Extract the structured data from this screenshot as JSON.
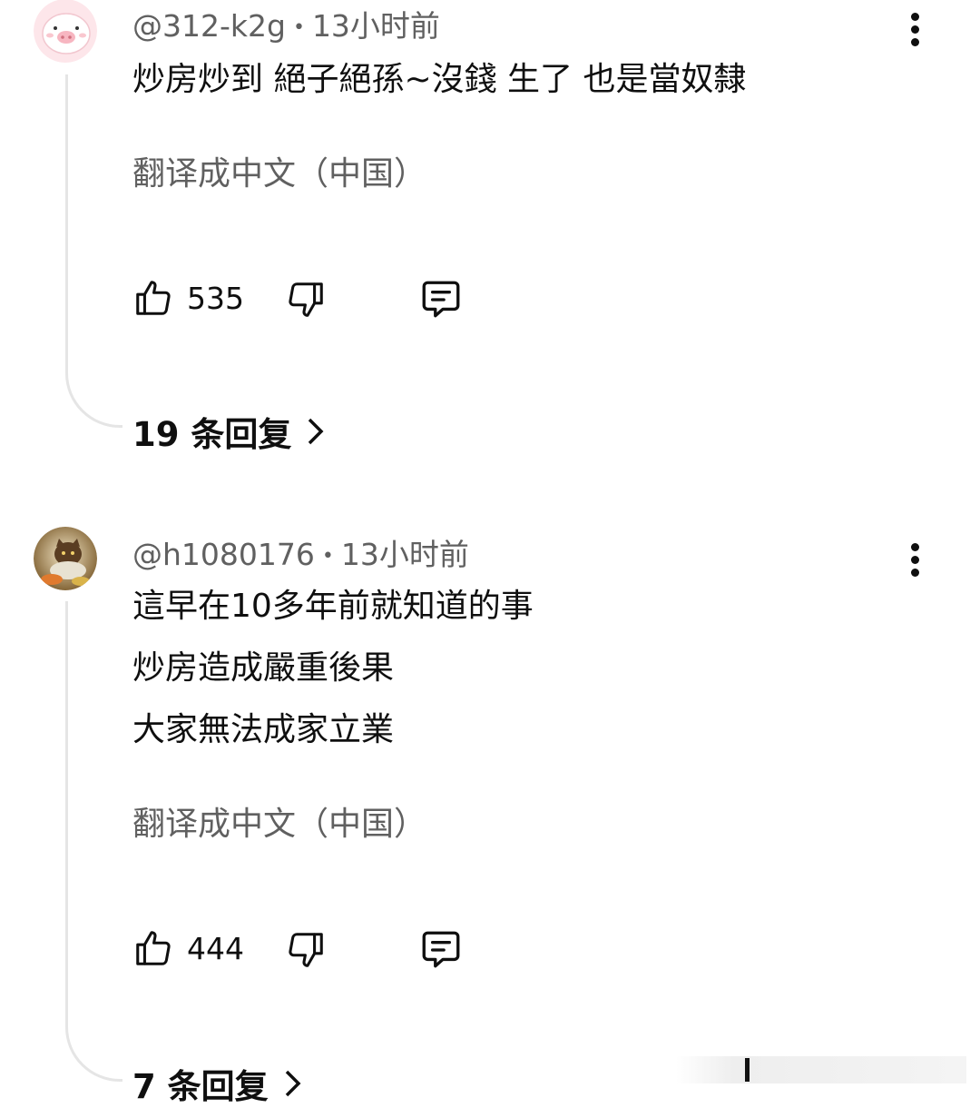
{
  "comments": [
    {
      "handle": "@312-k2g",
      "time": "13小时前",
      "lines": [
        "炒房炒到 絕子絕孫~沒錢 生了 也是當奴隸"
      ],
      "translate": "翻译成中文（中国）",
      "likes": "535",
      "replies": "19 条回复",
      "avatar_icon": "pig-avatar-icon"
    },
    {
      "handle": "@h1080176",
      "time": "13小时前",
      "lines": [
        "這早在10多年前就知道的事",
        "炒房造成嚴重後果",
        "大家無法成家立業"
      ],
      "translate": "翻译成中文（中国）",
      "likes": "444",
      "replies": "7 条回复",
      "avatar_icon": "cat-photo-avatar-icon"
    }
  ],
  "separator": "•",
  "icons": {
    "like": "thumbs-up-icon",
    "dislike": "thumbs-down-icon",
    "reply": "comment-icon",
    "more": "more-vert-icon",
    "chevron": "chevron-right-icon"
  }
}
